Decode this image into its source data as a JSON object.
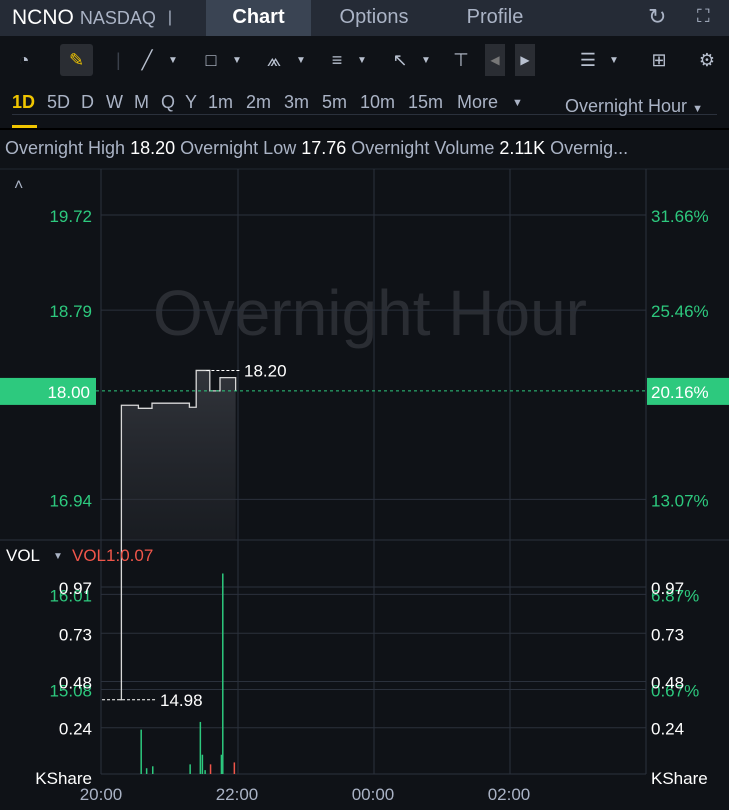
{
  "header": {
    "symbol": "NCNO",
    "exchange": "NASDAQ",
    "separator": "|",
    "tabs": [
      "Chart",
      "Options",
      "Profile"
    ],
    "active_tab": "Chart"
  },
  "periods": {
    "items": [
      "1D",
      "5D",
      "D",
      "W",
      "M",
      "Q",
      "Y",
      "1m",
      "2m",
      "3m",
      "5m",
      "10m",
      "15m",
      "More"
    ],
    "selected": "1D",
    "session": "Overnight Hour"
  },
  "stats": {
    "high_label": "Overnight High",
    "high": "18.20",
    "low_label": "Overnight Low",
    "low": "17.76",
    "vol_label": "Overnight Volume",
    "vol": "2.11K",
    "more": "Overnig..."
  },
  "watermark": "Overnight Hour",
  "colors": {
    "up": "#2dc97e",
    "down": "#f0564a",
    "accent": "#f0c500"
  },
  "chart_data": {
    "type": "line",
    "price_axis": {
      "left_ticks": [
        "19.72",
        "18.79",
        "16.94",
        "16.01",
        "15.08"
      ],
      "right_ticks": [
        "31.66%",
        "25.46%",
        "13.07%",
        "6.87%",
        "0.67%"
      ],
      "values": [
        19.72,
        18.79,
        16.94,
        16.01,
        15.08
      ]
    },
    "current_price": "18.00",
    "current_change": "20.16%",
    "current_value": 18.0,
    "high_marker": "18.20",
    "low_marker": "14.98",
    "x_ticks": [
      "20:00",
      "22:00",
      "00:00",
      "02:00"
    ],
    "price_series": [
      [
        20.28,
        14.98
      ],
      [
        20.3,
        17.86
      ],
      [
        20.5,
        17.86
      ],
      [
        20.55,
        17.83
      ],
      [
        20.7,
        17.83
      ],
      [
        20.75,
        17.88
      ],
      [
        21.2,
        17.88
      ],
      [
        21.3,
        17.84
      ],
      [
        21.35,
        17.84
      ],
      [
        21.4,
        18.2
      ],
      [
        21.55,
        18.2
      ],
      [
        21.6,
        18.0
      ],
      [
        21.7,
        18.0
      ],
      [
        21.75,
        18.13
      ],
      [
        21.95,
        18.13
      ],
      [
        21.98,
        18.0
      ]
    ],
    "volume": {
      "label": "VOL",
      "indicator": "VOL1:0.07",
      "unit": "KShare",
      "ticks": [
        "0.97",
        "0.73",
        "0.48",
        "0.24"
      ],
      "tick_values": [
        0.97,
        0.73,
        0.48,
        0.24
      ],
      "bars": [
        [
          20.58,
          0.23,
          "up"
        ],
        [
          20.66,
          0.03,
          "up"
        ],
        [
          20.75,
          0.04,
          "up"
        ],
        [
          21.3,
          0.05,
          "up"
        ],
        [
          21.45,
          0.27,
          "up"
        ],
        [
          21.48,
          0.1,
          "up"
        ],
        [
          21.52,
          0.02,
          "up"
        ],
        [
          21.6,
          0.05,
          "down"
        ],
        [
          21.76,
          0.1,
          "up"
        ],
        [
          21.78,
          1.04,
          "up"
        ],
        [
          21.95,
          0.06,
          "down"
        ]
      ]
    }
  }
}
